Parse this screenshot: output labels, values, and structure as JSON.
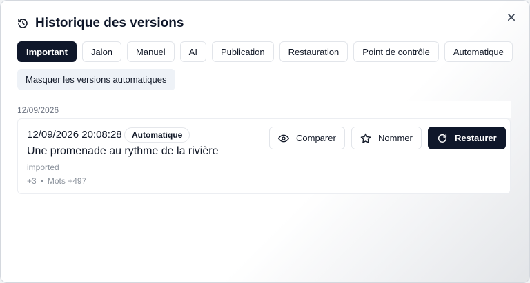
{
  "dialog": {
    "title": "Historique des versions",
    "filters": [
      {
        "label": "Important",
        "active": true
      },
      {
        "label": "Jalon"
      },
      {
        "label": "Manuel"
      },
      {
        "label": "AI"
      },
      {
        "label": "Publication"
      },
      {
        "label": "Restauration"
      },
      {
        "label": "Point de contrôle"
      },
      {
        "label": "Automatique"
      }
    ],
    "hide_auto_label": "Masquer les versions automatiques"
  },
  "group": {
    "date": "12/09/2026",
    "versions": [
      {
        "timestamp": "12/09/2026 20:08:28",
        "badge": "Automatique",
        "name": "Une promenade au rythme de la rivière",
        "source": "imported",
        "changes": "+3",
        "separator": "•",
        "words": "Mots +497",
        "actions": {
          "compare": "Comparer",
          "name": "Nommer",
          "restore": "Restaurer"
        }
      }
    ]
  },
  "colors": {
    "primary": "#0f172a",
    "muted": "#8b929c",
    "chip_border": "#e2e5ea",
    "toggle_bg": "#eef2f7"
  },
  "icons": {
    "title": "history-icon",
    "close": "close-icon",
    "compare": "eye-icon",
    "name": "star-icon",
    "restore": "refresh-icon"
  }
}
